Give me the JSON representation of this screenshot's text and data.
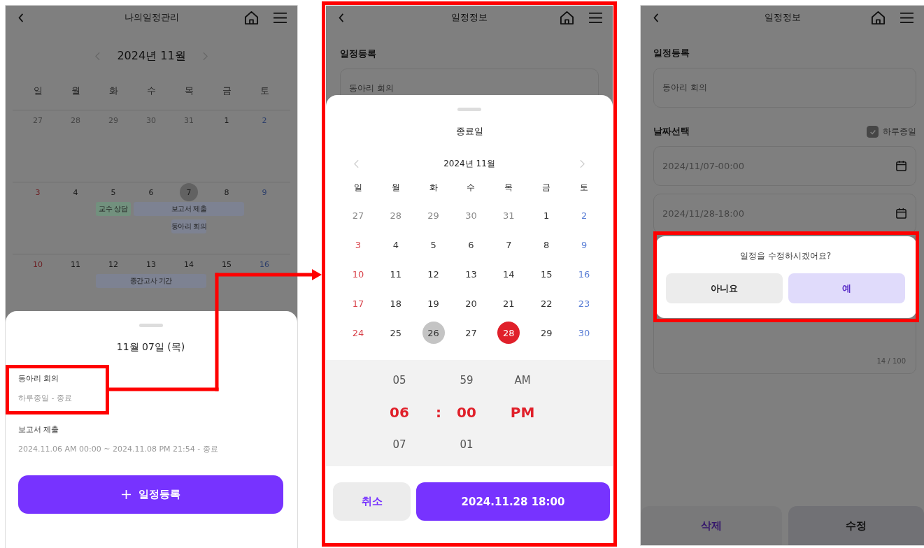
{
  "calendar_screen": {
    "header": {
      "title": "나의일정관리"
    },
    "month": "2024년 11월",
    "weekdays": [
      "일",
      "월",
      "화",
      "수",
      "목",
      "금",
      "토"
    ],
    "weeks": [
      {
        "days": [
          {
            "label": "27",
            "kind": "other",
            "selected": false
          },
          {
            "label": "28",
            "kind": "other",
            "selected": false
          },
          {
            "label": "29",
            "kind": "other",
            "selected": false
          },
          {
            "label": "30",
            "kind": "other",
            "selected": false
          },
          {
            "label": "31",
            "kind": "other",
            "selected": false
          },
          {
            "label": "1",
            "kind": "normal",
            "selected": false
          },
          {
            "label": "2",
            "kind": "sat",
            "selected": false
          }
        ]
      },
      {
        "days": [
          {
            "label": "3",
            "kind": "sun",
            "selected": false
          },
          {
            "label": "4",
            "kind": "normal",
            "selected": false
          },
          {
            "label": "5",
            "kind": "normal",
            "selected": false
          },
          {
            "label": "6",
            "kind": "normal",
            "selected": false
          },
          {
            "label": "7",
            "kind": "normal",
            "selected": true
          },
          {
            "label": "8",
            "kind": "normal",
            "selected": false
          },
          {
            "label": "9",
            "kind": "sat",
            "selected": false
          }
        ],
        "event_rows": [
          [
            {
              "kind": "empty"
            },
            {
              "kind": "empty"
            },
            {
              "kind": "event",
              "label": "교수 상담",
              "color": "#72917e"
            },
            {
              "kind": "event",
              "label": "보고서 제출",
              "color": "#7d8292"
            },
            {
              "kind": "more"
            },
            {
              "kind": "more"
            },
            {
              "kind": "empty"
            }
          ],
          [
            {
              "kind": "empty"
            },
            {
              "kind": "empty"
            },
            {
              "kind": "empty"
            },
            {
              "kind": "empty"
            },
            {
              "kind": "event",
              "label": "동아리 회의",
              "color": "#7d8292"
            },
            {
              "kind": "empty"
            },
            {
              "kind": "empty"
            }
          ]
        ]
      },
      {
        "days": [
          {
            "label": "10",
            "kind": "sun",
            "selected": false
          },
          {
            "label": "11",
            "kind": "normal",
            "selected": false
          },
          {
            "label": "12",
            "kind": "normal",
            "selected": false
          },
          {
            "label": "13",
            "kind": "normal",
            "selected": false
          },
          {
            "label": "14",
            "kind": "normal",
            "selected": false
          },
          {
            "label": "15",
            "kind": "normal",
            "selected": false
          },
          {
            "label": "16",
            "kind": "sat",
            "selected": false
          }
        ],
        "event_rows": [
          [
            {
              "kind": "empty"
            },
            {
              "kind": "empty"
            },
            {
              "kind": "event",
              "label": "중간고사 기간",
              "color": "#7d8292"
            },
            {
              "kind": "more"
            },
            {
              "kind": "more"
            },
            {
              "kind": "empty"
            },
            {
              "kind": "empty"
            }
          ]
        ]
      }
    ],
    "sheet": {
      "title": "11월 07일 (목)",
      "items": [
        {
          "title": "동아리 회의",
          "detail": "하루종일 - 종료"
        },
        {
          "title": "보고서 제출",
          "detail": "2024.11.06 AM 00:00 ~ 2024.11.08 PM 21:54 - 종료"
        }
      ],
      "button": "일정등록"
    }
  },
  "date_picker_screen": {
    "header": {
      "title": "일정정보"
    },
    "form_label": "일정등록",
    "title_value": "동아리 회의",
    "sheet": {
      "title": "종료일",
      "month": "2024년 11월",
      "weekdays": [
        "일",
        "월",
        "화",
        "수",
        "목",
        "금",
        "토"
      ],
      "weeks": [
        [
          {
            "label": "27",
            "kind": "other",
            "selected": false,
            "range_start": false
          },
          {
            "label": "28",
            "kind": "other",
            "selected": false,
            "range_start": false
          },
          {
            "label": "29",
            "kind": "other",
            "selected": false,
            "range_start": false
          },
          {
            "label": "30",
            "kind": "other",
            "selected": false,
            "range_start": false
          },
          {
            "label": "31",
            "kind": "other",
            "selected": false,
            "range_start": false
          },
          {
            "label": "1",
            "kind": "normal",
            "selected": false,
            "range_start": false
          },
          {
            "label": "2",
            "kind": "sat",
            "selected": false,
            "range_start": false
          }
        ],
        [
          {
            "label": "3",
            "kind": "sun",
            "selected": false,
            "range_start": false
          },
          {
            "label": "4",
            "kind": "normal",
            "selected": false,
            "range_start": false
          },
          {
            "label": "5",
            "kind": "normal",
            "selected": false,
            "range_start": false
          },
          {
            "label": "6",
            "kind": "normal",
            "selected": false,
            "range_start": false
          },
          {
            "label": "7",
            "kind": "normal",
            "selected": false,
            "range_start": false
          },
          {
            "label": "8",
            "kind": "normal",
            "selected": false,
            "range_start": false
          },
          {
            "label": "9",
            "kind": "sat",
            "selected": false,
            "range_start": false
          }
        ],
        [
          {
            "label": "10",
            "kind": "sun",
            "selected": false,
            "range_start": false
          },
          {
            "label": "11",
            "kind": "normal",
            "selected": false,
            "range_start": false
          },
          {
            "label": "12",
            "kind": "normal",
            "selected": false,
            "range_start": false
          },
          {
            "label": "13",
            "kind": "normal",
            "selected": false,
            "range_start": false
          },
          {
            "label": "14",
            "kind": "normal",
            "selected": false,
            "range_start": false
          },
          {
            "label": "15",
            "kind": "normal",
            "selected": false,
            "range_start": false
          },
          {
            "label": "16",
            "kind": "sat",
            "selected": false,
            "range_start": false
          }
        ],
        [
          {
            "label": "17",
            "kind": "sun",
            "selected": false,
            "range_start": false
          },
          {
            "label": "18",
            "kind": "normal",
            "selected": false,
            "range_start": false
          },
          {
            "label": "19",
            "kind": "normal",
            "selected": false,
            "range_start": false
          },
          {
            "label": "20",
            "kind": "normal",
            "selected": false,
            "range_start": false
          },
          {
            "label": "21",
            "kind": "normal",
            "selected": false,
            "range_start": false
          },
          {
            "label": "22",
            "kind": "normal",
            "selected": false,
            "range_start": false
          },
          {
            "label": "23",
            "kind": "sat",
            "selected": false,
            "range_start": false
          }
        ],
        [
          {
            "label": "24",
            "kind": "sun",
            "selected": false,
            "range_start": false
          },
          {
            "label": "25",
            "kind": "normal",
            "selected": false,
            "range_start": false
          },
          {
            "label": "26",
            "kind": "normal",
            "selected": false,
            "range_start": true
          },
          {
            "label": "27",
            "kind": "normal",
            "selected": false,
            "range_start": false
          },
          {
            "label": "28",
            "kind": "normal",
            "selected": true,
            "range_start": false
          },
          {
            "label": "29",
            "kind": "normal",
            "selected": false,
            "range_start": false
          },
          {
            "label": "30",
            "kind": "sat",
            "selected": false,
            "range_start": false
          }
        ]
      ],
      "time_rows": [
        {
          "selected": false,
          "hour": "05",
          "minute": "59",
          "period": "AM"
        },
        {
          "selected": true,
          "hour": "06",
          "separator": ":",
          "minute": "00",
          "period": "PM"
        },
        {
          "selected": false,
          "hour": "07",
          "minute": "01"
        }
      ],
      "cancel_button": "취소",
      "confirm_button": "2024.11.28 18:00"
    }
  },
  "confirm_screen": {
    "header": {
      "title": "일정정보"
    },
    "form_label": "일정등록",
    "title_value": "동아리 회의",
    "date_label": "날짜선택",
    "all_day": {
      "label": "하루종일",
      "checked": true
    },
    "start_value": "2024/11/07-00:00",
    "end_value": "2024/11/28-18:00",
    "memo_counter": "14 / 100",
    "delete_button": "삭제",
    "edit_button": "수정",
    "dialog": {
      "message": "일정을 수정하시겠어요?",
      "no_button": "아니요",
      "yes_button": "예"
    }
  }
}
